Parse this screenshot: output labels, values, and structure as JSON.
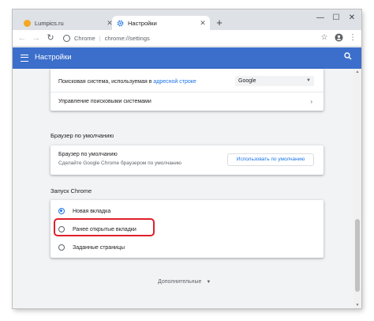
{
  "tabs": [
    {
      "label": "Lumpics.ru",
      "active": false,
      "icon": "lumpics-favicon"
    },
    {
      "label": "Настройки",
      "active": true,
      "icon": "settings-gear-favicon"
    }
  ],
  "window_controls": {
    "minimize": "—",
    "maximize": "☐",
    "close": "✕"
  },
  "toolbar": {
    "site": "Chrome",
    "separator": "|",
    "url": "chrome://settings"
  },
  "header": {
    "title": "Настройки"
  },
  "search_engine": {
    "label_prefix": "Поисковая система, используемая в ",
    "label_link": "адресной строке",
    "selected_engine": "Google",
    "manage_label": "Управление поисковыми системами"
  },
  "default_browser": {
    "section_title": "Браузер по умолчанию",
    "title": "Браузер по умолчанию",
    "description": "Сделайте Google Chrome браузером по умолчанию",
    "button": "Использовать по умолчанию"
  },
  "startup": {
    "section_title": "Запуск Chrome",
    "options": [
      {
        "label": "Новая вкладка",
        "checked": true
      },
      {
        "label": "Ранее открытые вкладки",
        "checked": false
      },
      {
        "label": "Заданные страницы",
        "checked": false
      }
    ]
  },
  "advanced": {
    "label": "Дополнительные"
  },
  "colors": {
    "accent": "#3c6fcb",
    "link": "#1a73e8",
    "highlight": "#e0202b"
  }
}
